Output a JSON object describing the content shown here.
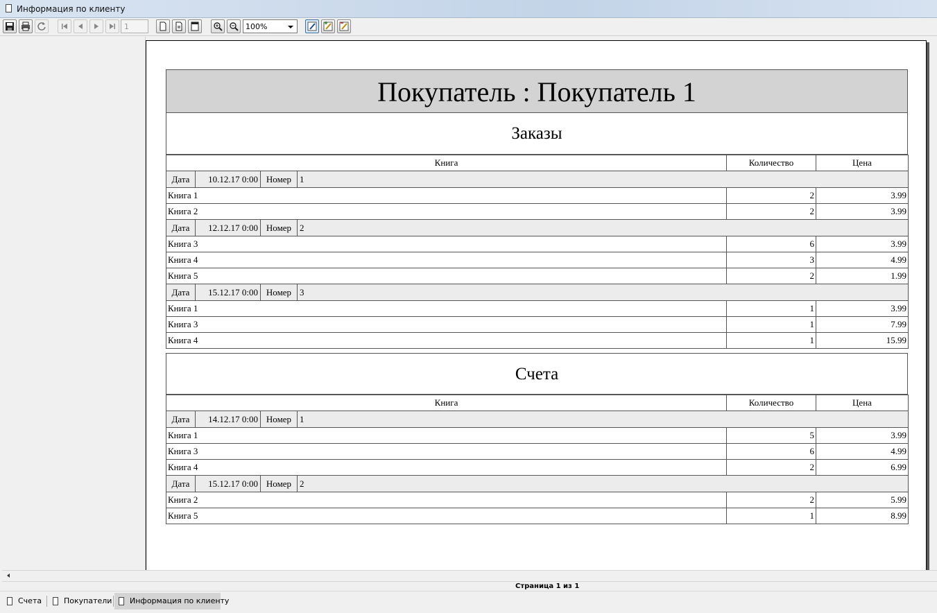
{
  "window": {
    "title": "Информация по клиенту"
  },
  "toolbar": {
    "page_value": "1",
    "zoom_value": "100%"
  },
  "report": {
    "header": "Покупатель : Покупатель 1",
    "columns": {
      "book": "Книга",
      "qty": "Количество",
      "price": "Цена"
    },
    "labels": {
      "date": "Дата",
      "number": "Номер"
    },
    "orders": {
      "title": "Заказы",
      "groups": [
        {
          "date": "10.12.17 0:00",
          "number": "1",
          "rows": [
            {
              "book": "Книга 1",
              "qty": "2",
              "price": "3.99"
            },
            {
              "book": "Книга 2",
              "qty": "2",
              "price": "3.99"
            }
          ]
        },
        {
          "date": "12.12.17 0:00",
          "number": "2",
          "rows": [
            {
              "book": "Книга 3",
              "qty": "6",
              "price": "3.99"
            },
            {
              "book": "Книга 4",
              "qty": "3",
              "price": "4.99"
            },
            {
              "book": "Книга 5",
              "qty": "2",
              "price": "1.99"
            }
          ]
        },
        {
          "date": "15.12.17 0:00",
          "number": "3",
          "rows": [
            {
              "book": "Книга 1",
              "qty": "1",
              "price": "3.99"
            },
            {
              "book": "Книга 3",
              "qty": "1",
              "price": "7.99"
            },
            {
              "book": "Книга 4",
              "qty": "1",
              "price": "15.99"
            }
          ]
        }
      ]
    },
    "invoices": {
      "title": "Счета",
      "groups": [
        {
          "date": "14.12.17 0:00",
          "number": "1",
          "rows": [
            {
              "book": "Книга 1",
              "qty": "5",
              "price": "3.99"
            },
            {
              "book": "Книга 3",
              "qty": "6",
              "price": "4.99"
            },
            {
              "book": "Книга 4",
              "qty": "2",
              "price": "6.99"
            }
          ]
        },
        {
          "date": "15.12.17 0:00",
          "number": "2",
          "rows": [
            {
              "book": "Книга 2",
              "qty": "2",
              "price": "5.99"
            },
            {
              "book": "Книга 5",
              "qty": "1",
              "price": "8.99"
            }
          ]
        }
      ]
    }
  },
  "status": {
    "page_text": "Страница 1 из 1"
  },
  "tabs": [
    {
      "label": "Счета"
    },
    {
      "label": "Покупатели"
    },
    {
      "label": "Информация по клиенту"
    }
  ]
}
